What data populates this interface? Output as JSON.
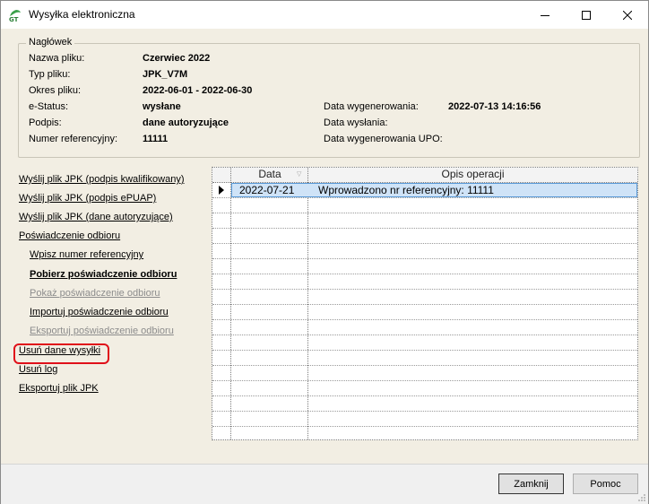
{
  "window": {
    "title": "Wysyłka elektroniczna",
    "app_icon_text": "GT"
  },
  "header": {
    "legend": "Nagłówek",
    "rows": [
      {
        "label": "Nazwa pliku:",
        "value": "Czerwiec 2022"
      },
      {
        "label": "Typ pliku:",
        "value": "JPK_V7M"
      },
      {
        "label": "Okres pliku:",
        "value": "2022-06-01 - 2022-06-30"
      },
      {
        "label": "e-Status:",
        "value": "wysłane"
      },
      {
        "label": "Podpis:",
        "value": "dane autoryzujące"
      },
      {
        "label": "Numer referencyjny:",
        "value": "11111"
      }
    ],
    "right_rows": [
      {
        "label": "Data wygenerowania:",
        "value": "2022-07-13 14:16:56"
      },
      {
        "label": "Data wysłania:",
        "value": ""
      },
      {
        "label": "Data wygenerowania UPO:",
        "value": ""
      }
    ]
  },
  "actions": [
    {
      "label": "Wyślij plik JPK (podpis kwalifikowany)",
      "enabled": true
    },
    {
      "label": "Wyślij plik JPK (podpis ePUAP)",
      "enabled": true
    },
    {
      "label": "Wyślij plik JPK (dane autoryzujące)",
      "enabled": true
    },
    {
      "label": "Poświadczenie odbioru",
      "enabled": true
    },
    {
      "label": "Wpisz numer referencyjny",
      "enabled": true
    },
    {
      "label": "Pobierz poświadczenie odbioru",
      "enabled": true
    },
    {
      "label": "Pokaż poświadczenie odbioru",
      "enabled": false
    },
    {
      "label": "Importuj poświadczenie odbioru",
      "enabled": true
    },
    {
      "label": "Eksportuj poświadczenie odbioru",
      "enabled": false
    },
    {
      "label": "Usuń dane wysyłki",
      "enabled": true
    },
    {
      "label": "Usuń log",
      "enabled": true
    },
    {
      "label": "Eksportuj plik JPK",
      "enabled": true
    }
  ],
  "log_grid": {
    "columns": [
      "Data",
      "Opis operacji"
    ],
    "rows": [
      {
        "date": "2022-07-21",
        "description": "Wprowadzono nr referencyjny: 11111"
      }
    ]
  },
  "footer": {
    "close_label": "Zamknij",
    "help_label": "Pomoc"
  },
  "colors": {
    "dialog_bg": "#f2eee3",
    "selection_bg": "#cfe3f7",
    "selection_border": "#5a9ad8",
    "highlight_red": "#e0101a",
    "disabled_text": "#8c8c8c"
  }
}
